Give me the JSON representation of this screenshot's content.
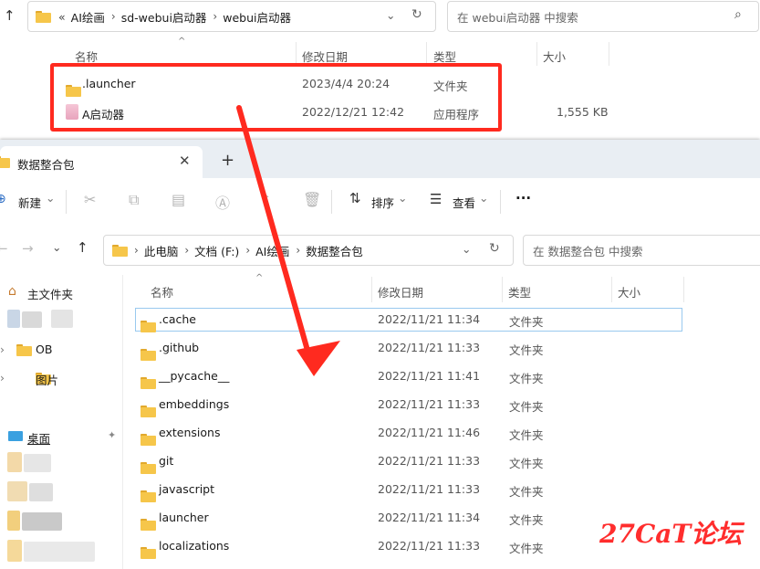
{
  "back_window": {
    "address_crumbs": [
      "AI绘画",
      "sd-webui启动器",
      "webui启动器"
    ],
    "overflow_glyph": "«",
    "search_placeholder": "在 webui启动器 中搜索",
    "columns": {
      "name": "名称",
      "date": "修改日期",
      "type": "类型",
      "size": "大小"
    },
    "files": [
      {
        "name": ".launcher",
        "date": "2023/4/4 20:24",
        "type": "文件夹",
        "size": "",
        "icon": "folder-icon"
      },
      {
        "name": "A启动器",
        "date": "2022/12/21 12:42",
        "type": "应用程序",
        "size": "1,555 KB",
        "icon": "app-icon"
      }
    ]
  },
  "front_window": {
    "tab_title": "数据整合包",
    "toolbar": {
      "new": "新建",
      "sort": "排序",
      "view": "查看",
      "more": "···"
    },
    "address_crumbs": [
      "此电脑",
      "文档 (F:)",
      "AI绘画",
      "数据整合包"
    ],
    "search_placeholder": "在 数据整合包 中搜索",
    "sidebar": {
      "home": "主文件夹",
      "ob": "OB",
      "pictures": "图片",
      "desktop": "桌面"
    },
    "columns": {
      "name": "名称",
      "date": "修改日期",
      "type": "类型",
      "size": "大小"
    },
    "files": [
      {
        "name": ".cache",
        "date": "2022/11/21 11:34",
        "type": "文件夹"
      },
      {
        "name": ".github",
        "date": "2022/11/21 11:33",
        "type": "文件夹"
      },
      {
        "name": "__pycache__",
        "date": "2022/11/21 11:41",
        "type": "文件夹"
      },
      {
        "name": "embeddings",
        "date": "2022/11/21 11:33",
        "type": "文件夹"
      },
      {
        "name": "extensions",
        "date": "2022/11/21 11:46",
        "type": "文件夹"
      },
      {
        "name": "git",
        "date": "2022/11/21 11:33",
        "type": "文件夹"
      },
      {
        "name": "javascript",
        "date": "2022/11/21 11:33",
        "type": "文件夹"
      },
      {
        "name": "launcher",
        "date": "2022/11/21 11:34",
        "type": "文件夹"
      },
      {
        "name": "localizations",
        "date": "2022/11/21 11:33",
        "type": "文件夹"
      }
    ]
  },
  "watermark": "27CaT论坛",
  "colors": {
    "annotation_red": "#ff2a1f",
    "folder_yellow": "#f6c64a",
    "selection_border": "#99c9ef"
  }
}
